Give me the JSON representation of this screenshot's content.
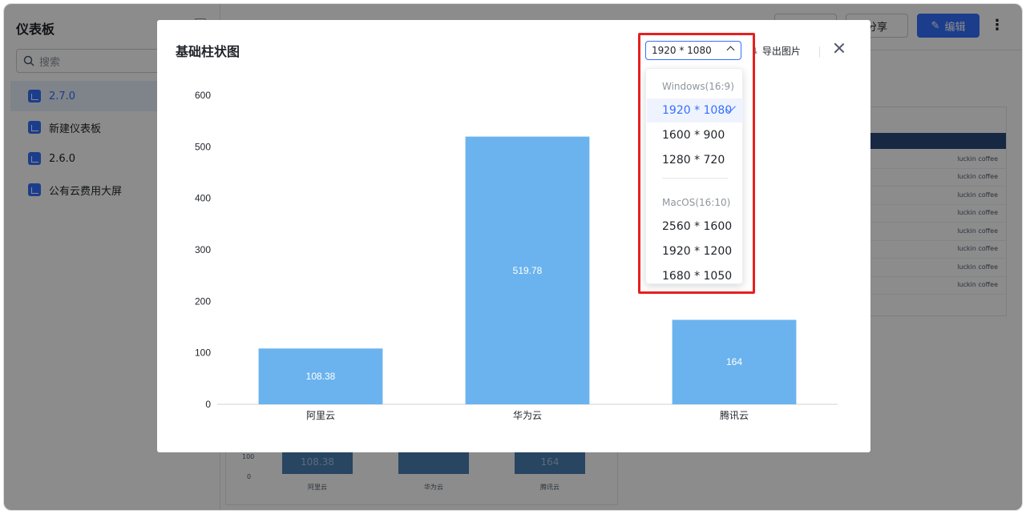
{
  "sidebar": {
    "title": "仪表板",
    "search_placeholder": "搜索",
    "items": [
      {
        "label": "2.7.0",
        "active": true
      },
      {
        "label": "新建仪表板",
        "active": false
      },
      {
        "label": "2.6.0",
        "active": false
      },
      {
        "label": "公有云费用大屏",
        "active": false
      }
    ]
  },
  "topbar": {
    "share_label": "分享",
    "edit_label": "编辑",
    "more_label": "⋮"
  },
  "background_table": {
    "rows": [
      "luckin coffee",
      "luckin coffee",
      "luckin coffee",
      "luckin coffee",
      "luckin coffee",
      "luckin coffee",
      "luckin coffee",
      "luckin coffee"
    ]
  },
  "background_chart": {
    "ytick_100": "100",
    "ytick_0": "0",
    "bars": [
      "108.38",
      "",
      "164"
    ],
    "categories": [
      "阿里云",
      "华为云",
      "腾讯云"
    ]
  },
  "modal": {
    "title": "基础柱状图",
    "resolution_value": "1920 * 1080",
    "export_label": "导出图片",
    "dropdown": {
      "groups": [
        {
          "label": "Windows(16:9)",
          "options": [
            "1920 * 1080",
            "1600 * 900",
            "1280 * 720"
          ]
        },
        {
          "label": "MacOS(16:10)",
          "options": [
            "2560 * 1600",
            "1920 * 1200",
            "1680 * 1050"
          ]
        }
      ],
      "selected": "1920 * 1080"
    }
  },
  "colors": {
    "accent": "#3370ff",
    "bar": "#6bb3ee",
    "highlight": "#e6201f"
  },
  "chart_data": {
    "type": "bar",
    "categories": [
      "阿里云",
      "华为云",
      "腾讯云"
    ],
    "values": [
      108.38,
      519.78,
      164
    ],
    "value_labels": [
      "108.38",
      "519.78",
      "164"
    ],
    "yticks": [
      0,
      100,
      200,
      300,
      400,
      500,
      600
    ],
    "ylim": [
      0,
      600
    ],
    "grid": false
  }
}
